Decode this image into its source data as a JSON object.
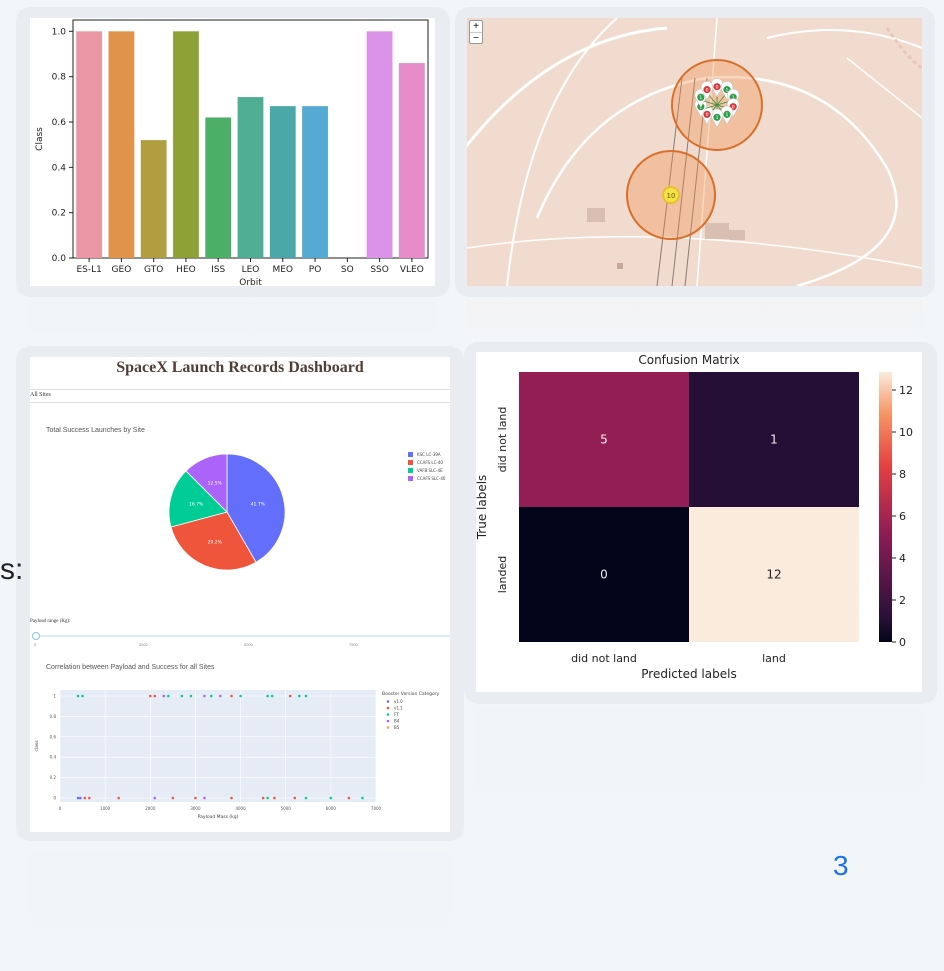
{
  "slide": {
    "page_number": "3",
    "side_fragment": "s:"
  },
  "bar_chart": {
    "chart_data": {
      "type": "bar",
      "categories": [
        "ES-L1",
        "GEO",
        "GTO",
        "HEO",
        "ISS",
        "LEO",
        "MEO",
        "PO",
        "SO",
        "SSO",
        "VLEO"
      ],
      "values": [
        1.0,
        1.0,
        0.52,
        1.0,
        0.62,
        0.71,
        0.67,
        0.67,
        0.0,
        1.0,
        0.86
      ],
      "colors": [
        "#ea96a3",
        "#e0944b",
        "#b09e41",
        "#8da137",
        "#4caf67",
        "#50ae93",
        "#4ba8a8",
        "#55a9d2",
        "#9ea1f0",
        "#da92e8",
        "#e88bc9"
      ],
      "xlabel": "Orbit",
      "ylabel": "Class",
      "ylim": [
        0,
        1.05
      ],
      "yticks": [
        "0.0",
        "0.2",
        "0.4",
        "0.6",
        "0.8",
        "1.0"
      ]
    }
  },
  "map": {
    "zoom_in": "+",
    "zoom_out": "−",
    "cluster_count": "10",
    "markers": [
      "0",
      "1",
      "1",
      "0",
      "1",
      "1",
      "0",
      "1",
      "1",
      "0"
    ]
  },
  "dashboard": {
    "title": "SpaceX Launch Records Dashboard",
    "dropdown_value": "All Sites",
    "pie_title": "Total Success Launches by Site",
    "pie": {
      "labels": [
        "KSC LC-39A",
        "CCAFS LC-40",
        "VAFB SLC-4E",
        "CCAFS SLC-40"
      ],
      "values": [
        41.7,
        29.2,
        16.7,
        12.5
      ],
      "colors": [
        "#636efa",
        "#ef553b",
        "#00cc96",
        "#ab63fa"
      ],
      "value_labels": [
        "41.7%",
        "29.2%",
        "16.7%",
        "12.5%"
      ]
    },
    "slider_label": "Payload range (Kg):",
    "slider_ticks": [
      "0",
      "2500",
      "5000",
      "7500"
    ],
    "scatter_title": "Correlation between Payload and Success for all Sites",
    "scatter_xlabel": "Payload Mass (kg)",
    "scatter_ylabel": "class",
    "scatter_xticks": [
      "0",
      "1000",
      "2000",
      "3000",
      "4000",
      "5000",
      "6000",
      "7000"
    ],
    "scatter_yticks": [
      "0",
      "0.2",
      "0.4",
      "0.6",
      "0.8",
      "1"
    ],
    "legend_title": "Booster Version Category",
    "legend": [
      {
        "name": "v1.0",
        "color": "#636efa"
      },
      {
        "name": "v1.1",
        "color": "#ef553b"
      },
      {
        "name": "FT",
        "color": "#00cc96"
      },
      {
        "name": "B4",
        "color": "#ab63fa"
      },
      {
        "name": "B5",
        "color": "#ffa15a"
      }
    ],
    "chart_data": {
      "type": "scatter",
      "x_range": [
        0,
        7000
      ],
      "y_range": [
        0,
        1
      ],
      "points_success": [
        [
          400,
          "#00cc96"
        ],
        [
          500,
          "#00cc96"
        ],
        [
          2000,
          "#ef553b"
        ],
        [
          2100,
          "#ef553b"
        ],
        [
          2300,
          "#ab63fa"
        ],
        [
          2400,
          "#00cc96"
        ],
        [
          2700,
          "#00cc96"
        ],
        [
          2900,
          "#00cc96"
        ],
        [
          3200,
          "#ab63fa"
        ],
        [
          3350,
          "#00cc96"
        ],
        [
          3550,
          "#ab63fa"
        ],
        [
          3800,
          "#ef553b"
        ],
        [
          4000,
          "#00cc96"
        ],
        [
          4600,
          "#00cc96"
        ],
        [
          4700,
          "#00cc96"
        ],
        [
          5100,
          "#ef553b"
        ],
        [
          5300,
          "#00cc96"
        ],
        [
          5450,
          "#00cc96"
        ]
      ],
      "points_failure": [
        [
          400,
          "#636efa"
        ],
        [
          450,
          "#636efa"
        ],
        [
          550,
          "#ef553b"
        ],
        [
          650,
          "#ef553b"
        ],
        [
          1300,
          "#ef553b"
        ],
        [
          2100,
          "#ab63fa"
        ],
        [
          2500,
          "#ef553b"
        ],
        [
          3000,
          "#ef553b"
        ],
        [
          3200,
          "#ab63fa"
        ],
        [
          3800,
          "#ef553b"
        ],
        [
          4500,
          "#ef553b"
        ],
        [
          4600,
          "#00cc96"
        ],
        [
          4750,
          "#ef553b"
        ],
        [
          5200,
          "#ef553b"
        ],
        [
          5450,
          "#00cc96"
        ],
        [
          6000,
          "#00cc96"
        ],
        [
          6400,
          "#ef553b"
        ],
        [
          6700,
          "#00cc96"
        ]
      ]
    }
  },
  "confusion": {
    "chart_data": {
      "type": "heatmap",
      "title": "Confusion Matrix",
      "xlabel": "Predicted labels",
      "ylabel": "True labels",
      "x_categories": [
        "did not land",
        "land"
      ],
      "y_categories": [
        "did not land",
        "landed"
      ],
      "values": [
        [
          5,
          1
        ],
        [
          0,
          12
        ]
      ],
      "colorbar_ticks": [
        "0",
        "2",
        "4",
        "6",
        "8",
        "10",
        "12"
      ],
      "colorbar_range": [
        0,
        12
      ]
    }
  }
}
